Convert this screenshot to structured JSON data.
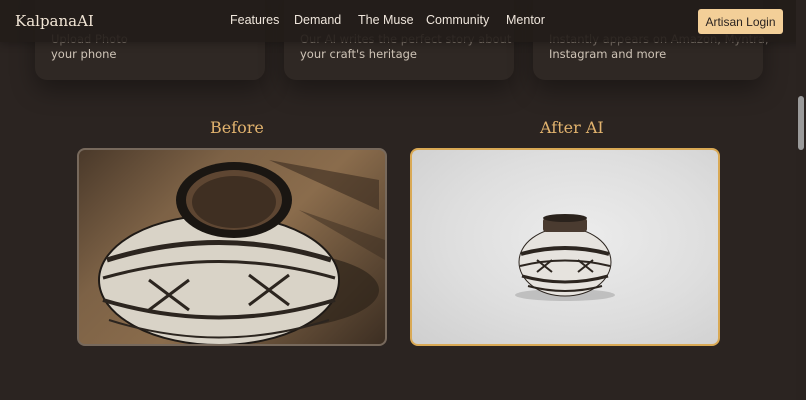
{
  "nav": {
    "brand": "KalpanaAI",
    "links": [
      "Features",
      "Demand",
      "The Muse",
      "Community",
      "Mentor"
    ],
    "login": "Artisan Login"
  },
  "features": [
    {
      "line1": "Upload Photo",
      "line2": "your phone"
    },
    {
      "line1": "Our AI writes the perfect story about",
      "line2": "your craft's heritage"
    },
    {
      "line1": "Instantly appears on Amazon, Myntra,",
      "line2": "Instagram and more"
    }
  ],
  "comparison": {
    "before_label": "Before",
    "after_label": "After AI"
  },
  "colors": {
    "background": "#2b2421",
    "accent": "#f3cf98",
    "label": "#e2b36e",
    "after_border": "#d9a955"
  }
}
